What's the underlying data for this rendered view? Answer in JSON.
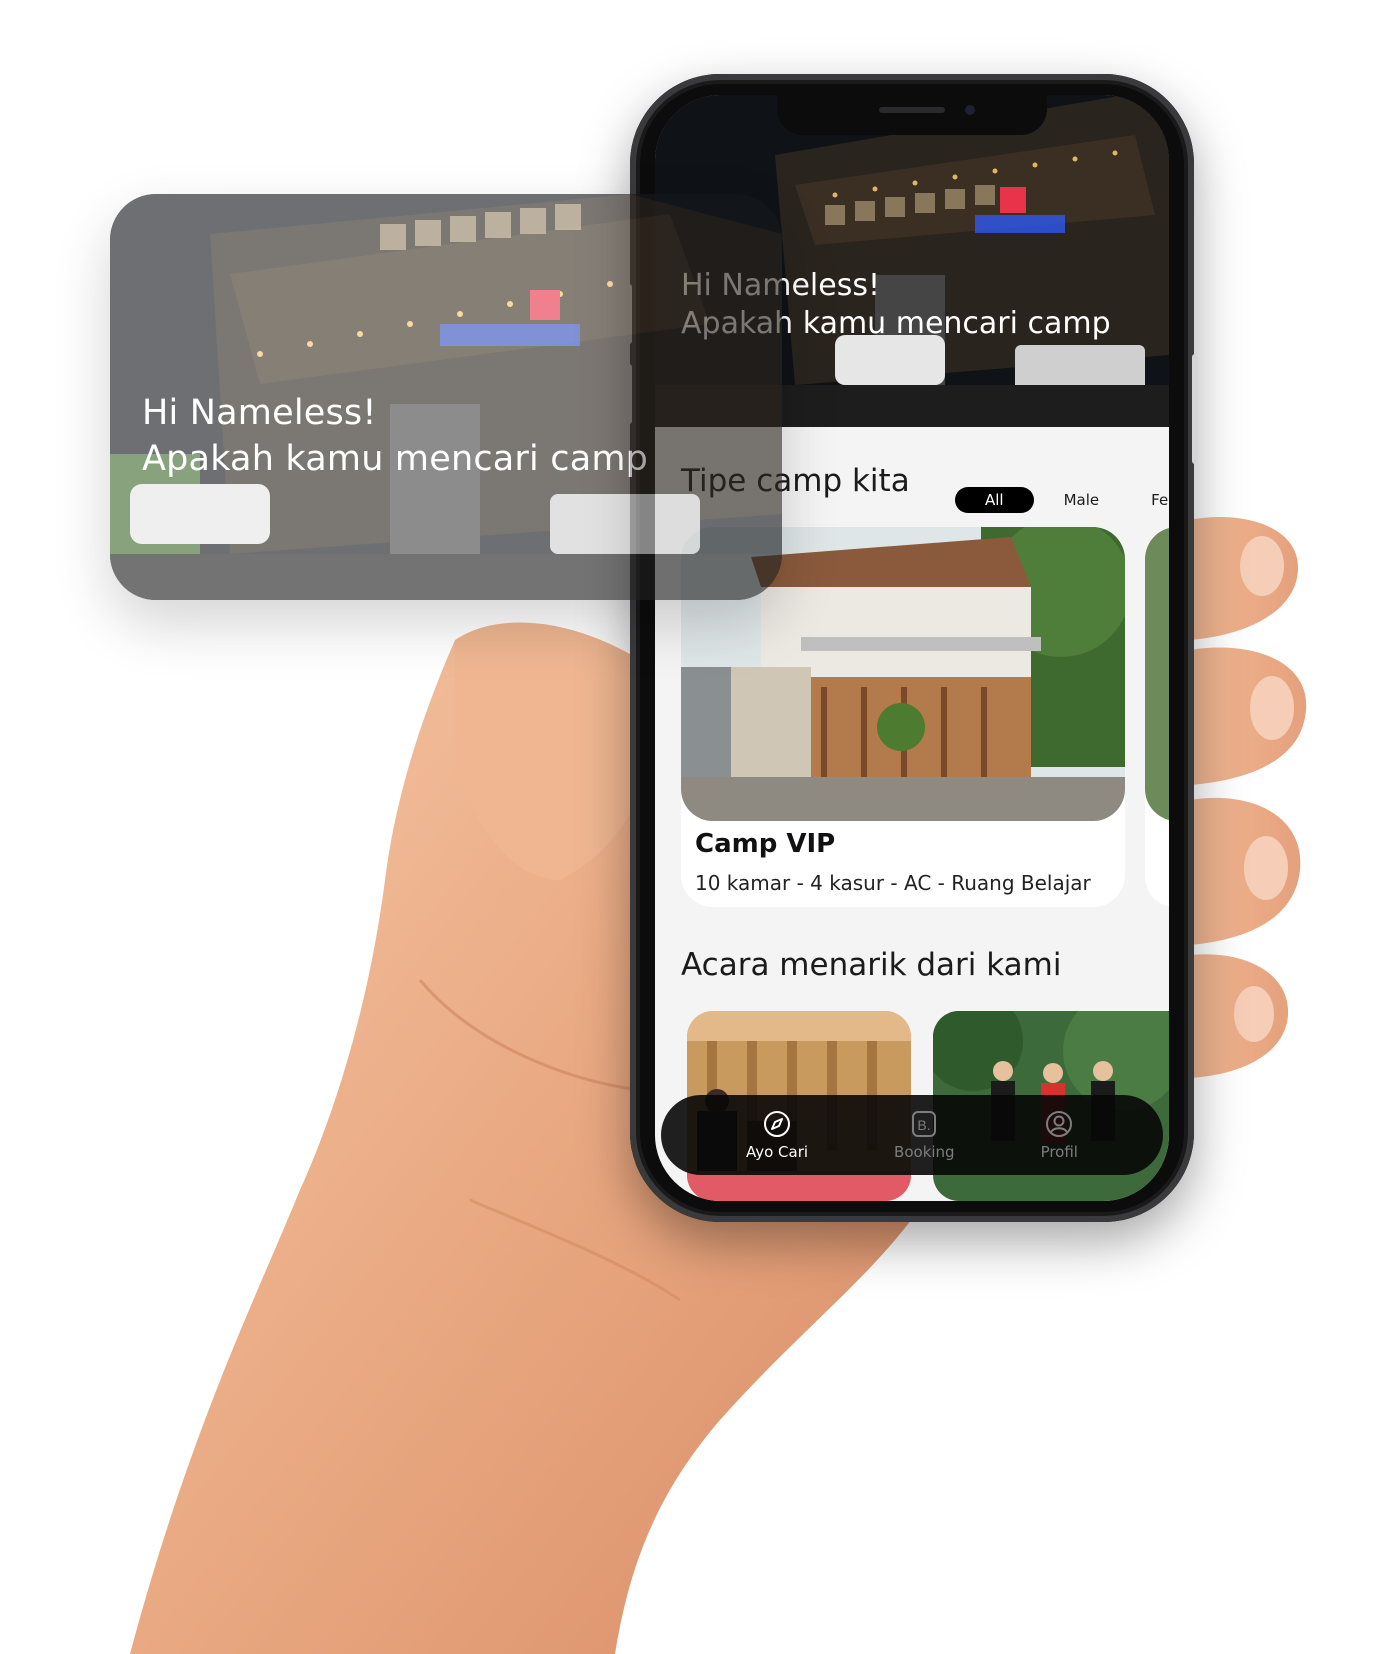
{
  "hero": {
    "greeting": "Hi Nameless!",
    "subtitle": "Apakah kamu mencari camp"
  },
  "camp_section": {
    "title": "Tipe camp kita",
    "filters": [
      {
        "label": "All",
        "selected": true
      },
      {
        "label": "Male",
        "selected": false
      },
      {
        "label": "Fema",
        "selected": false
      }
    ],
    "cards": [
      {
        "name": "Camp VIP",
        "description": "10 kamar - 4 kasur - AC - Ruang Belajar"
      }
    ]
  },
  "events_section": {
    "title": "Acara menarik dari kami"
  },
  "bottom_nav": {
    "items": [
      {
        "label": "Ayo Cari",
        "icon": "compass-icon",
        "active": true
      },
      {
        "label": "Booking",
        "icon": "booking-icon",
        "active": false
      },
      {
        "label": "Profil",
        "icon": "profile-icon",
        "active": false
      }
    ]
  },
  "colors": {
    "screen_background": "#f4f4f4",
    "chip_active": "#000000",
    "nav_background": "#080808",
    "nav_inactive": "#7d7d7d"
  }
}
